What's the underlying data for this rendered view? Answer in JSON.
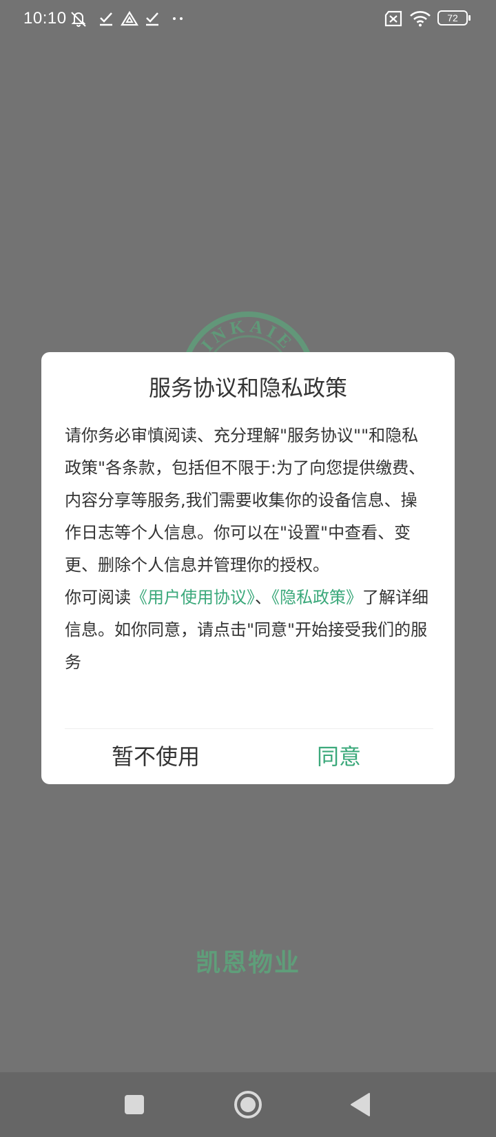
{
  "status_bar": {
    "time": "10:10",
    "battery_level": "72",
    "icons": [
      "mute-icon",
      "check-icon",
      "drive-icon",
      "check-icon",
      "more-dots-icon",
      "no-sim-icon",
      "wifi-icon",
      "battery-icon"
    ]
  },
  "background": {
    "logo_text": "INKAIE",
    "brand_name": "凯恩物业"
  },
  "dialog": {
    "title": "服务协议和隐私政策",
    "paragraph1": "请你务必审慎阅读、充分理解\"服务协议\"\"和隐私政策\"各条款，包括但不限于:为了向您提供缴费、内容分享等服务,我们需要收集你的设备信息、操作日志等个人信息。你可以在\"设置\"中查看、变更、删除个人信息并管理你的授权。",
    "p2_prefix": "你可阅读",
    "link_user_agreement": "《用户使用协议》",
    "separator": "、",
    "link_privacy_policy": "《隐私政策》",
    "p2_suffix": "了解详细信息。如你同意，请点击\"同意\"开始接受我们的服务",
    "decline_label": "暂不使用",
    "agree_label": "同意"
  },
  "colors": {
    "accent": "#3aa87a",
    "overlay": "#737373",
    "nav_bar": "#666666"
  },
  "nav_bar": {
    "buttons": [
      "recents-button",
      "home-button",
      "back-button"
    ]
  }
}
